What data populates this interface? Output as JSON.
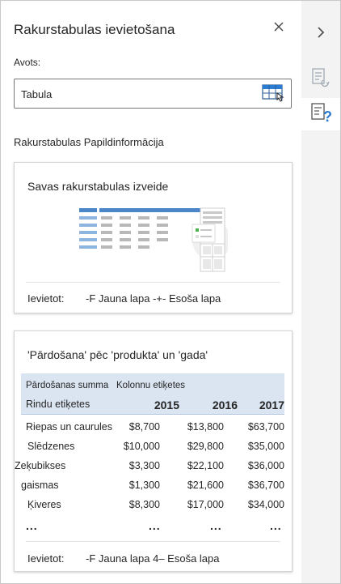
{
  "pane": {
    "title": "Rakurstabulas ievietošana",
    "close_icon": "close-icon",
    "source_label": "Avots:",
    "source_value": "Tabula",
    "section_title": "Rakurstabulas Papildinformācija"
  },
  "rail": {
    "collapse_icon": "chevron-right-icon",
    "items": [
      "fields-list-icon",
      "pivot-help-icon"
    ]
  },
  "cards": [
    {
      "title": "Savas rakurstabulas izveide",
      "insert_label": "Ievietot:",
      "insert_options": "-F Jauna lapa -+- Esoša lapa"
    },
    {
      "title": "'Pārdošana' pēc 'produkta' un 'gada'",
      "insert_label": "Ievietot:",
      "insert_options": "-F Jauna lapa 4– Esoša lapa",
      "table": {
        "sum_label": "Pārdošanas summa",
        "col_label": "Kolonnu etiķetes",
        "row_label": "Rindu etiķetes",
        "years": [
          "2015",
          "2016",
          "2017"
        ],
        "rows": [
          {
            "name": "Riepas un caurules",
            "values": [
              "$8,700",
              "$13,800",
              "$63,700"
            ]
          },
          {
            "name": "Slēdzenes",
            "values": [
              "$10,000",
              "$29,800",
              "$35,000"
            ]
          },
          {
            "name": "Zeķubikses",
            "values": [
              "$3,300",
              "$22,100",
              "$36,000"
            ]
          },
          {
            "name": "gaismas",
            "values": [
              "$1,300",
              "$21,600",
              "$36,700"
            ]
          },
          {
            "name": "Ķiveres",
            "values": [
              "$8,300",
              "$17,000",
              "$34,000"
            ]
          }
        ],
        "ellipsis": "..."
      }
    }
  ],
  "colors": {
    "accent": "#2b7cd3",
    "header_bg": "#dbe5f1",
    "rail_bg": "#f3f3f3"
  }
}
